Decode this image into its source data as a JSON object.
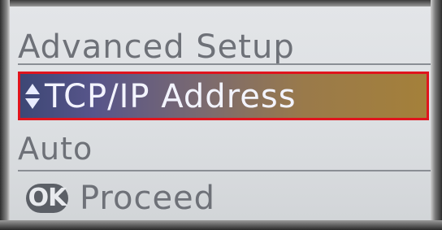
{
  "screen": {
    "title": "Advanced Setup",
    "selected_item": {
      "label": "TCP/IP Address",
      "icon": "up-down-arrows-icon"
    },
    "value": "Auto",
    "footer": {
      "button_label": "OK",
      "action_label": "Proceed"
    }
  },
  "colors": {
    "highlight_start": "#3d4775",
    "highlight_end": "#a4803a",
    "outline": "#e0141d",
    "text": "#6e7178"
  }
}
